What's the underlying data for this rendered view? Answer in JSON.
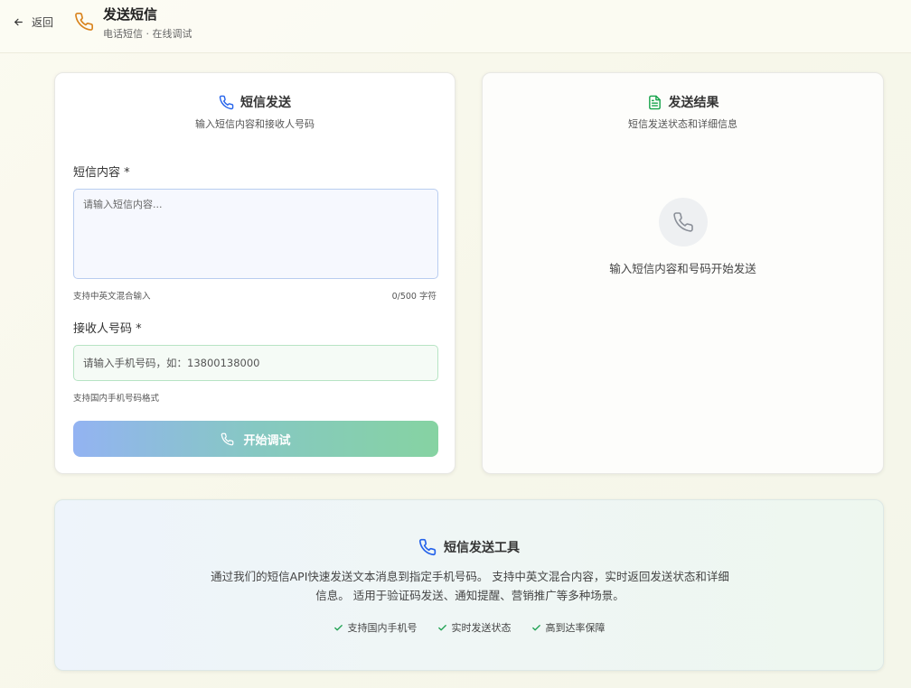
{
  "header": {
    "back_label": "返回",
    "title": "发送短信",
    "subtitle": "电话短信 · 在线调试",
    "icon": "phone-icon",
    "icon_color": "#d9841e"
  },
  "send_card": {
    "icon": "phone-icon",
    "title": "短信发送",
    "subtitle": "输入短信内容和接收人号码",
    "content_label": "短信内容 *",
    "content_placeholder": "请输入短信内容...",
    "content_hint": "支持中英文混合输入",
    "content_counter": "0/500 字符",
    "phone_label": "接收人号码 *",
    "phone_placeholder": "请输入手机号码，如：13800138000",
    "phone_hint": "支持国内手机号码格式",
    "submit_label": "开始调试",
    "accent_color": "#2563eb"
  },
  "result_card": {
    "icon": "document-icon",
    "title": "发送结果",
    "subtitle": "短信发送状态和详细信息",
    "empty_icon": "phone-icon",
    "empty_text": "输入短信内容和号码开始发送",
    "accent_color": "#16a34a"
  },
  "info_card": {
    "icon": "phone-icon",
    "title": "短信发送工具",
    "description": "通过我们的短信API快速发送文本消息到指定手机号码。 支持中英文混合内容，实时返回发送状态和详细信息。 适用于验证码发送、通知提醒、营销推广等多种场景。",
    "features": [
      {
        "icon": "check-icon",
        "label": "支持国内手机号"
      },
      {
        "icon": "check-icon",
        "label": "实时发送状态"
      },
      {
        "icon": "check-icon",
        "label": "高到达率保障"
      }
    ],
    "check_color": "#22a355"
  }
}
